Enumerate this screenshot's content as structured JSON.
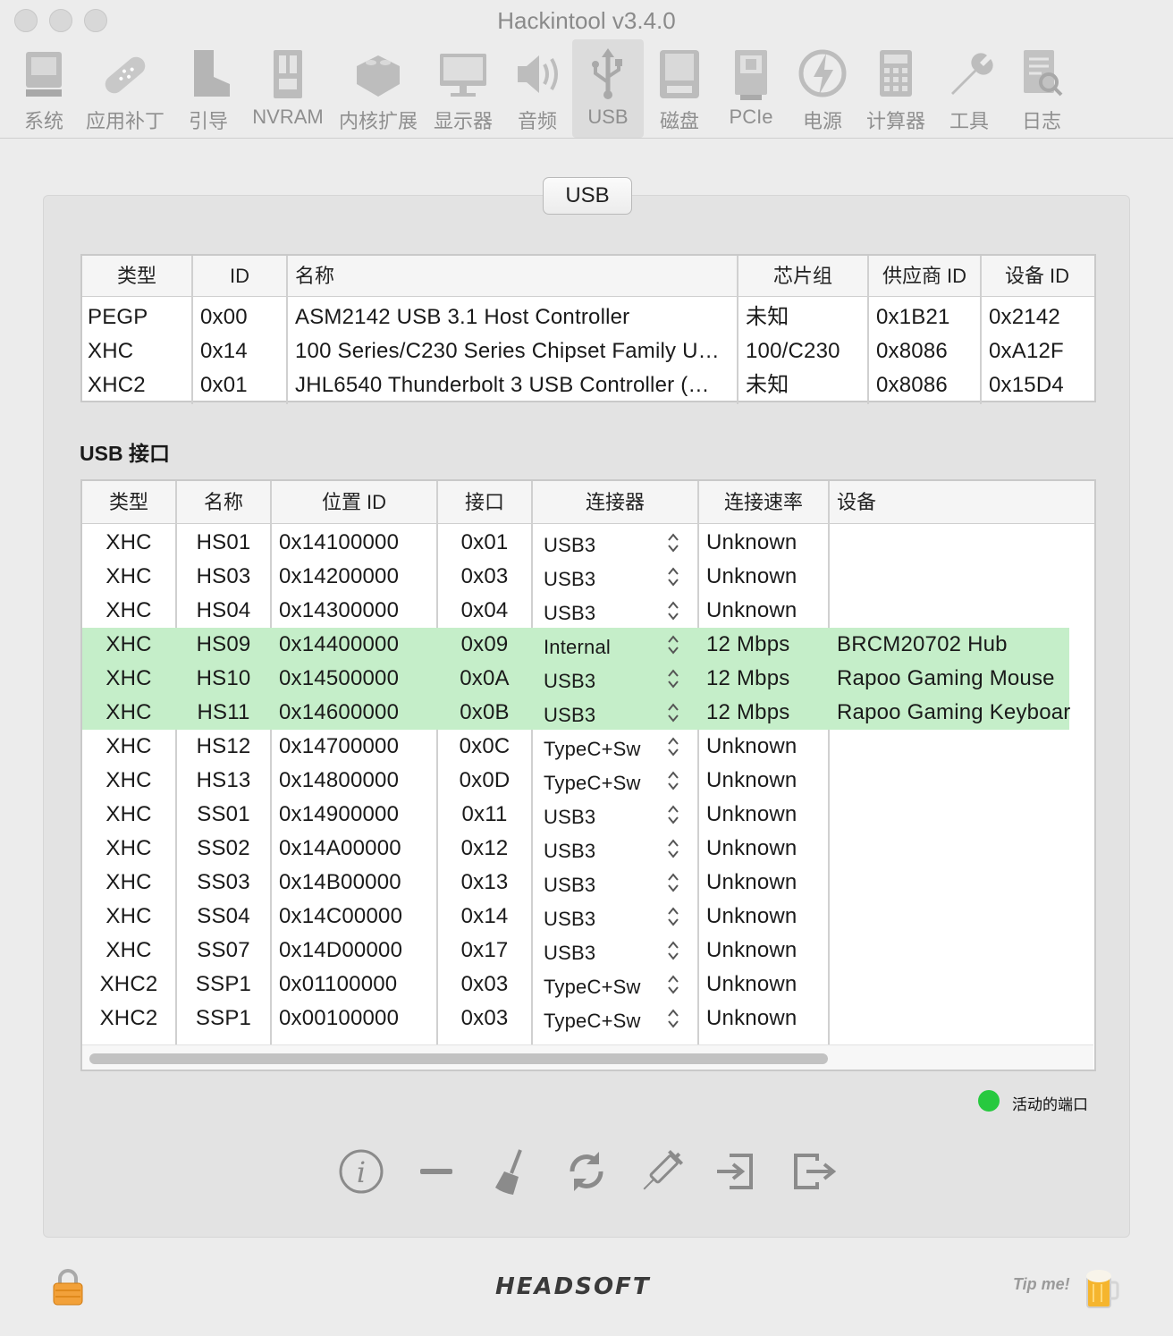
{
  "window": {
    "title": "Hackintool v3.4.0"
  },
  "toolbar": [
    {
      "label": "系统",
      "icon": "system-icon"
    },
    {
      "label": "应用补丁",
      "icon": "patch-icon"
    },
    {
      "label": "引导",
      "icon": "boot-icon"
    },
    {
      "label": "NVRAM",
      "icon": "nvram-icon"
    },
    {
      "label": "内核扩展",
      "icon": "kext-icon"
    },
    {
      "label": "显示器",
      "icon": "display-icon"
    },
    {
      "label": "音频",
      "icon": "audio-icon"
    },
    {
      "label": "USB",
      "icon": "usb-icon"
    },
    {
      "label": "磁盘",
      "icon": "disk-icon"
    },
    {
      "label": "PCIe",
      "icon": "pcie-icon"
    },
    {
      "label": "电源",
      "icon": "power-icon"
    },
    {
      "label": "计算器",
      "icon": "calculator-icon"
    },
    {
      "label": "工具",
      "icon": "tools-icon"
    },
    {
      "label": "日志",
      "icon": "log-icon"
    }
  ],
  "tab": {
    "label": "USB"
  },
  "controllers": {
    "headers": [
      "类型",
      "ID",
      "名称",
      "芯片组",
      "供应商 ID",
      "设备 ID"
    ],
    "rows": [
      [
        "PEGP",
        "0x00",
        "ASM2142 USB 3.1 Host Controller",
        "未知",
        "0x1B21",
        "0x2142"
      ],
      [
        "XHC",
        "0x14",
        "100 Series/C230 Series Chipset Family U…",
        "100/C230",
        "0x8086",
        "0xA12F"
      ],
      [
        "XHC2",
        "0x01",
        "JHL6540 Thunderbolt 3 USB Controller (…",
        "未知",
        "0x8086",
        "0x15D4"
      ]
    ]
  },
  "ports_section_title": "USB 接口",
  "ports": {
    "headers": [
      "类型",
      "名称",
      "位置 ID",
      "接口",
      "连接器",
      "连接速率",
      "设备"
    ],
    "rows": [
      [
        "XHC",
        "HS01",
        "0x14100000",
        "0x01",
        "USB3",
        "Unknown",
        ""
      ],
      [
        "XHC",
        "HS03",
        "0x14200000",
        "0x03",
        "USB3",
        "Unknown",
        ""
      ],
      [
        "XHC",
        "HS04",
        "0x14300000",
        "0x04",
        "USB3",
        "Unknown",
        ""
      ],
      [
        "XHC",
        "HS09",
        "0x14400000",
        "0x09",
        "Internal",
        "12 Mbps",
        "BRCM20702 Hub"
      ],
      [
        "XHC",
        "HS10",
        "0x14500000",
        "0x0A",
        "USB3",
        "12 Mbps",
        "Rapoo Gaming Mouse"
      ],
      [
        "XHC",
        "HS11",
        "0x14600000",
        "0x0B",
        "USB3",
        "12 Mbps",
        "Rapoo Gaming Keyboar"
      ],
      [
        "XHC",
        "HS12",
        "0x14700000",
        "0x0C",
        "TypeC+Sw",
        "Unknown",
        ""
      ],
      [
        "XHC",
        "HS13",
        "0x14800000",
        "0x0D",
        "TypeC+Sw",
        "Unknown",
        ""
      ],
      [
        "XHC",
        "SS01",
        "0x14900000",
        "0x11",
        "USB3",
        "Unknown",
        ""
      ],
      [
        "XHC",
        "SS02",
        "0x14A00000",
        "0x12",
        "USB3",
        "Unknown",
        ""
      ],
      [
        "XHC",
        "SS03",
        "0x14B00000",
        "0x13",
        "USB3",
        "Unknown",
        ""
      ],
      [
        "XHC",
        "SS04",
        "0x14C00000",
        "0x14",
        "USB3",
        "Unknown",
        ""
      ],
      [
        "XHC",
        "SS07",
        "0x14D00000",
        "0x17",
        "USB3",
        "Unknown",
        ""
      ],
      [
        "XHC2",
        "SSP1",
        "0x01100000",
        "0x03",
        "TypeC+Sw",
        "Unknown",
        ""
      ],
      [
        "XHC2",
        "SSP1",
        "0x00100000",
        "0x03",
        "TypeC+Sw",
        "Unknown",
        ""
      ]
    ],
    "active_rows": [
      3,
      4,
      5
    ],
    "active_color": "#c5eec9"
  },
  "legend": {
    "label": "活动的端口",
    "color": "#27c93f"
  },
  "actions": [
    "info-icon",
    "remove-icon",
    "clean-icon",
    "refresh-icon",
    "inject-icon",
    "import-icon",
    "export-icon"
  ],
  "footer": {
    "brand": "HEADSOFT",
    "tip": "Tip me!"
  }
}
